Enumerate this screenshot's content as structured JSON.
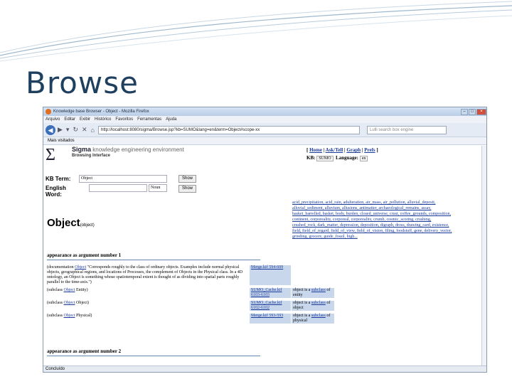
{
  "slide": {
    "title": "Browse"
  },
  "browser": {
    "window_title": "Knowledge base Browser - Object - Mozilla Firefox",
    "menu": [
      "Arquivo",
      "Editar",
      "Exibir",
      "Histórico",
      "Favoritos",
      "Ferramentas",
      "Ajuda"
    ],
    "url": "http://localhost:8080/sigma/Browse.jsp?kb=SUMO&lang=en&term=Object#scope-xx",
    "search_placeholder": "Lulli search box engine",
    "bookmark": "Mais visitados",
    "status": "Concluído"
  },
  "page": {
    "logo_symbol": "Σ",
    "logo_name": "Sigma",
    "logo_tagline": "knowledge engineering environment",
    "logo_sub": "Browsing Interface",
    "nav": [
      "Home",
      "Ask/Tell",
      "Graph",
      "Prefs"
    ],
    "kb_label": "KB:",
    "kb_value": "SUMO",
    "language_label": "Language:",
    "language_value": "en",
    "kb_term_label": "KB Term:",
    "kb_term_value": "Object",
    "english_word_label": "English Word:",
    "pos_value": "Noun",
    "show_label": "Show",
    "object_title": "Object",
    "object_subtitle": "(object)",
    "related_terms": "acid_precipitation, acid_rain, adulteration, air_mass, air_pollution, alluvial_deposit, alluvial_sediment, alluvium, allusions, antimatter, archaeological_remains, assay, basket_barrelled, basket, body, burden, closed_universe, crust, coffee_grounds, composition, continent, corporeality, corporeal, corporeality, crumb, cosmic_scoring, crushing, crushed_rock, dark_matter, depression, deposition, digraph, dross, drawing_card, existence, field, field_of_regard, field_of_view, field_of_vision, filing, foodstuff, gene, delivery_vector, grinding, grocery, guide_fossil, high...",
    "section1_heading": "appearance as argument number 1",
    "section2_heading": "appearance as argument number 2",
    "rows": [
      {
        "pre": "(documentation ",
        "link": "Object",
        "text": " \"Corresponds roughly to the class of ordinary objects. Examples include normal physical objects, geographical regions, and locations of Processes, the complement of Objects in the Physical class. In a 4D ontology, an Object is something whose spatiotemporal extent is thought of as dividing into spatial parts roughly parallel to the time-axis.\")",
        "source": "Merge.kif 594-609",
        "desc_pre": "",
        "desc_link": "",
        "desc_post": ""
      },
      {
        "pre": "(subclass ",
        "link": "Object",
        "text": " Entity)",
        "source": "SUMO_Cache.kif 6103-6103",
        "desc_pre": "object is a ",
        "desc_link": "subclass",
        "desc_post": " of entity"
      },
      {
        "pre": "(subclass ",
        "link": "Object",
        "text": " Object)",
        "source": "SUMO_Cache.kif 6102-6102",
        "desc_pre": "object is a ",
        "desc_link": "subclass",
        "desc_post": " of object"
      },
      {
        "pre": "(subclass ",
        "link": "Object",
        "text": " Physical)",
        "source": "Merge.kif 593-593",
        "desc_pre": "object is a ",
        "desc_link": "subclass",
        "desc_post": " of physical"
      }
    ]
  }
}
